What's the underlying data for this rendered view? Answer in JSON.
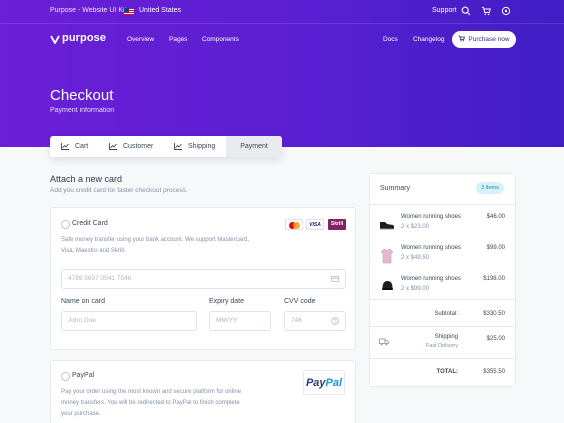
{
  "topbar": {
    "brand": "Purpose - Website UI Kit",
    "country": "United States",
    "support": "Support"
  },
  "nav": {
    "logo": "purpose",
    "links": [
      "Overview",
      "Pages",
      "Components"
    ],
    "right_links": [
      "Docs",
      "Changelog"
    ],
    "cta": "Purchase now"
  },
  "hero": {
    "title": "Checkout",
    "subtitle": "Payment information"
  },
  "steps": [
    "Cart",
    "Customer",
    "Shipping",
    "Payment"
  ],
  "active_step": "Payment",
  "section": {
    "title": "Attach a new card",
    "subtitle": "Add you credit card for faster checkout process."
  },
  "credit_card": {
    "title": "Credit Card",
    "description_line1": "Safe money transfer using your bank account. We support Mastercard,",
    "description_line2": "Visa, Maestro and Skrill.",
    "badges": [
      "VISA",
      "Skrill"
    ],
    "card_number_placeholder": "4789 5697 0541 7546",
    "name_label": "Name on card",
    "name_placeholder": "John Doe",
    "expiry_label": "Expiry date",
    "expiry_placeholder": "MM/YY",
    "cvv_label": "CVV code",
    "cvv_placeholder": "746"
  },
  "paypal": {
    "title": "PayPal",
    "description_line1": "Pay your order using the most known and secure platform for online",
    "description_line2": "money transfers. You will be redirected to PayPal to finish complete",
    "description_line3": "your purchase.",
    "logo_part1": "Pay",
    "logo_part2": "Pal"
  },
  "summary": {
    "title": "Summary",
    "items_badge": "3 items",
    "products": [
      {
        "name": "Women running shoes",
        "qty": "2 x $23.00",
        "price": "$46.00",
        "icon": "shoe-icon"
      },
      {
        "name": "Women running shoes",
        "qty": "2 x $49.50",
        "price": "$99.00",
        "icon": "shirt-icon"
      },
      {
        "name": "Women running shoes",
        "qty": "2 x $99.00",
        "price": "$198.00",
        "icon": "cap-icon"
      }
    ],
    "subtotal_label": "Subtotal:",
    "subtotal": "$330.50",
    "shipping_label": "Shipping",
    "shipping_method": "Fast Delivery",
    "shipping": "$25.00",
    "total_label": "TOTAL:",
    "total": "$355.50"
  },
  "colors": {
    "hero_start": "#6b1fd6",
    "hero_end": "#3f1ec4",
    "badge_bg": "#d6f2fb",
    "paypal_blue": "#253b80"
  }
}
